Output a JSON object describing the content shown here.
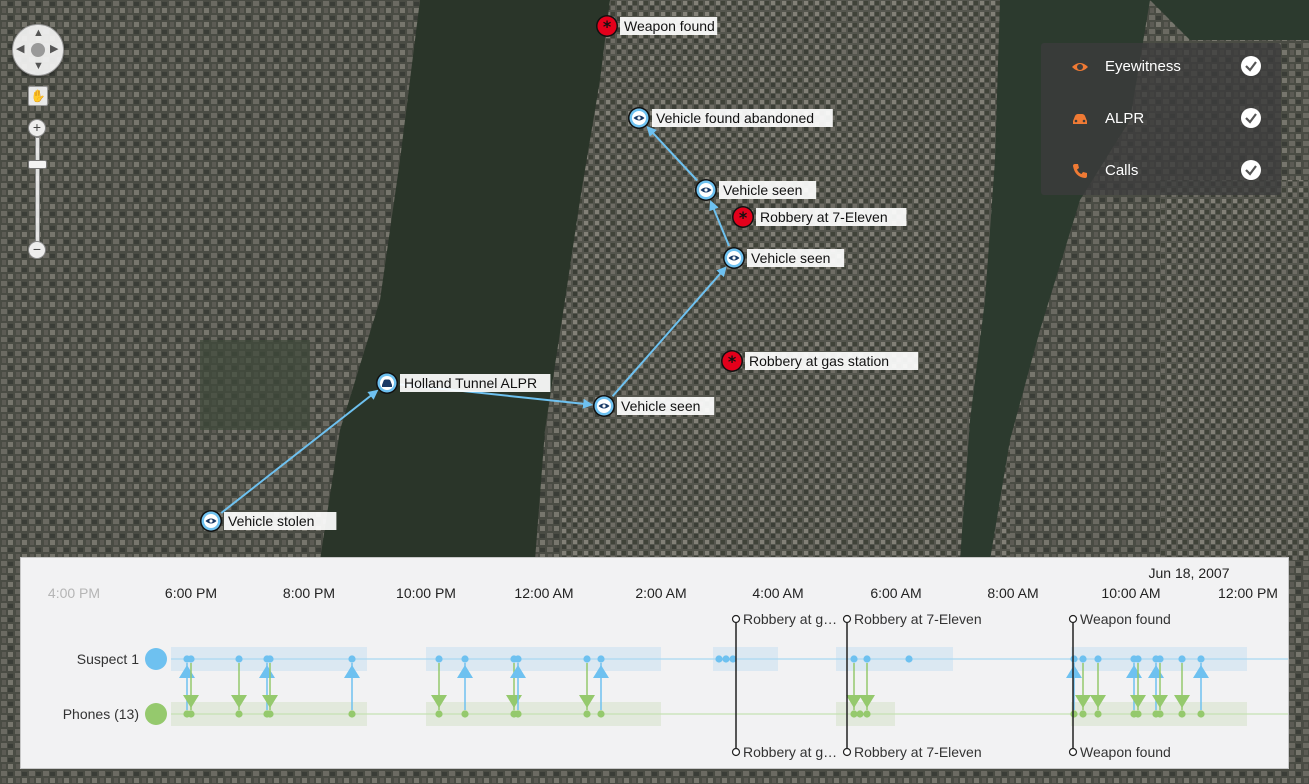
{
  "map": {
    "nodes": [
      {
        "id": "weapon",
        "kind": "incident",
        "label": "Weapon found"
      },
      {
        "id": "abandoned",
        "kind": "eyewitness",
        "label": "Vehicle found abandoned"
      },
      {
        "id": "seen3",
        "kind": "eyewitness",
        "label": "Vehicle seen"
      },
      {
        "id": "rob711",
        "kind": "incident",
        "label": "Robbery at 7-Eleven"
      },
      {
        "id": "seen2",
        "kind": "eyewitness",
        "label": "Vehicle seen"
      },
      {
        "id": "robgas",
        "kind": "incident",
        "label": "Robbery at gas station"
      },
      {
        "id": "holland",
        "kind": "alpr",
        "label": "Holland Tunnel ALPR"
      },
      {
        "id": "seen1",
        "kind": "eyewitness",
        "label": "Vehicle seen"
      },
      {
        "id": "stolen",
        "kind": "eyewitness",
        "label": "Vehicle stolen"
      }
    ],
    "links": [
      [
        "stolen",
        "holland"
      ],
      [
        "holland",
        "seen1"
      ],
      [
        "seen1",
        "seen2"
      ],
      [
        "seen2",
        "seen3"
      ],
      [
        "seen3",
        "abandoned"
      ]
    ]
  },
  "legend": {
    "items": [
      {
        "label": "Eyewitness",
        "icon": "eye-icon",
        "checked": true
      },
      {
        "label": "ALPR",
        "icon": "car-icon",
        "checked": true
      },
      {
        "label": "Calls",
        "icon": "phone-icon",
        "checked": true
      }
    ],
    "icon_color": "#f07a34"
  },
  "nav": {
    "zoom_in": "+",
    "zoom_out": "−"
  },
  "timeline": {
    "date_label": "Jun 18, 2007",
    "ticks": [
      "4:00 PM",
      "6:00 PM",
      "8:00 PM",
      "10:00 PM",
      "12:00 AM",
      "2:00 AM",
      "4:00 AM",
      "6:00 AM",
      "8:00 AM",
      "10:00 AM",
      "12:00 PM"
    ],
    "rows": [
      {
        "label": "Suspect 1",
        "color": "#6ec1f0"
      },
      {
        "label": "Phones (13)",
        "color": "#95c96d"
      }
    ],
    "events": [
      {
        "label_top": "Robbery at g…",
        "label_bottom": "Robbery at g…"
      },
      {
        "label_top": "Robbery at 7-Eleven",
        "label_bottom": "Robbery at 7-Eleven"
      },
      {
        "label_top": "Weapon found",
        "label_bottom": "Weapon found"
      }
    ]
  },
  "colors": {
    "link": "#6ec1f0",
    "incident": "#e3001b",
    "eyewitness_ring": "#6ec1f0"
  }
}
